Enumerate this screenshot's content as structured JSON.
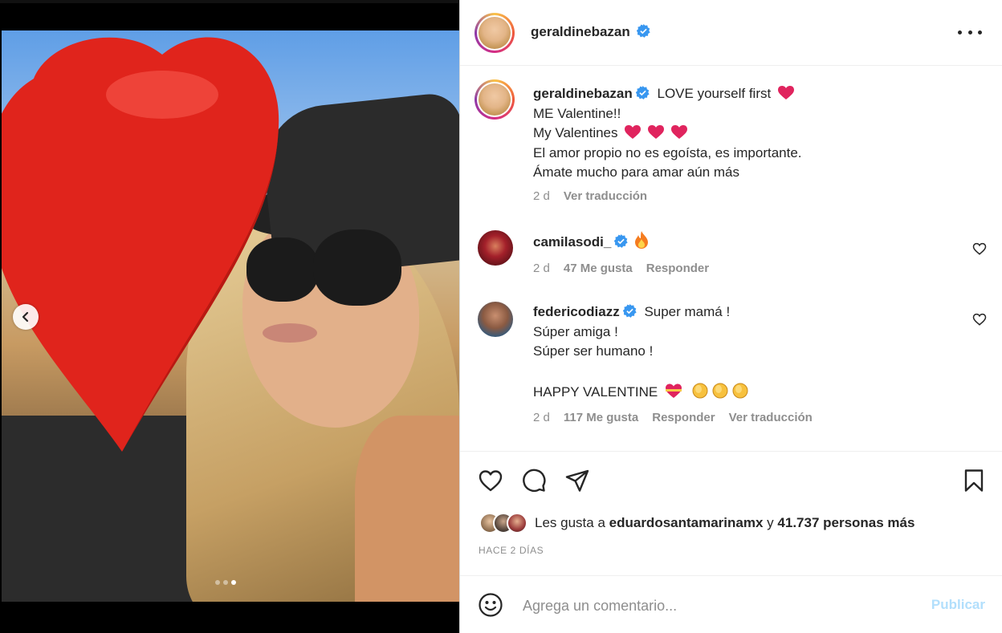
{
  "post": {
    "author": "geraldinebazan",
    "carousel": {
      "slide_count": 3,
      "active_index": 2
    }
  },
  "caption": {
    "author": "geraldinebazan",
    "lines": [
      "LOVE yourself first",
      "ME Valentine!!",
      "My Valentines",
      "El amor propio no es egoísta, es importante.",
      "Ámate mucho para amar aún más"
    ],
    "time": "2 d",
    "translate": "Ver traducción"
  },
  "comments": [
    {
      "author": "camilasodi_",
      "text": "",
      "time": "2 d",
      "likes": "47 Me gusta",
      "reply": "Responder"
    },
    {
      "author": "federicodiazz",
      "lines": [
        "Super mamá !",
        "Súper amiga !",
        "Súper ser humano !",
        "",
        "HAPPY VALENTINE"
      ],
      "time": "2 d",
      "likes": "117 Me gusta",
      "reply": "Responder",
      "translate": "Ver traducción"
    }
  ],
  "likes": {
    "prefix": "Les gusta a",
    "user": "eduardosantamarinamx",
    "connector": "y",
    "others": "41.737 personas más"
  },
  "posted_ago": "HACE 2 DÍAS",
  "composer": {
    "placeholder": "Agrega un comentario...",
    "publish": "Publicar"
  },
  "colors": {
    "verified": "#3897f0",
    "heart": "#e0245e",
    "publish": "#b2dffc"
  },
  "icons": [
    "chevron-left-icon",
    "more-icon",
    "heart-outline-icon",
    "comment-icon",
    "share-icon",
    "bookmark-icon",
    "emoji-icon",
    "verified-icon"
  ]
}
